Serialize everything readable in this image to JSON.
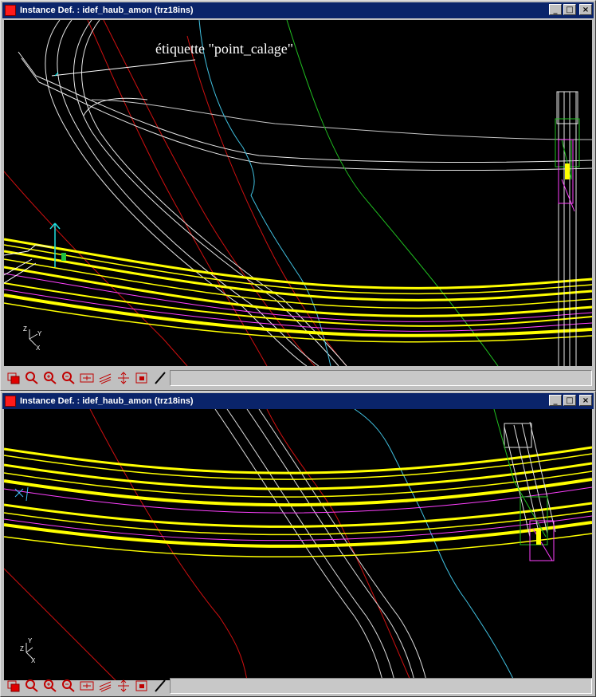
{
  "windows": [
    {
      "title": "Instance Def. : idef_haub_amon (trz18ins)",
      "annotation": "étiquette \"point_calage\"",
      "axes": {
        "z": "Z",
        "y": "Y",
        "x": "X"
      }
    },
    {
      "title": "Instance Def. : idef_haub_amon (trz18ins)",
      "axes": {
        "z": "Z",
        "y": "Y",
        "x": "X"
      }
    }
  ],
  "window_buttons": {
    "minimize": "_",
    "maximize": "□",
    "close": "×"
  },
  "toolbar_icons": [
    "window-icon",
    "zoom-icon",
    "zoom-in-icon",
    "zoom-out-icon",
    "fit-view-icon",
    "layers-icon",
    "pan-icon",
    "region-icon",
    "line-tool-icon"
  ],
  "colors": {
    "title_bg": "#0a246a",
    "viewport_bg": "#000000",
    "road": "#ffff00",
    "contour_red": "#d01010",
    "river_cyan": "#40c0e0",
    "green": "#20c020",
    "magenta": "#ff40ff"
  }
}
